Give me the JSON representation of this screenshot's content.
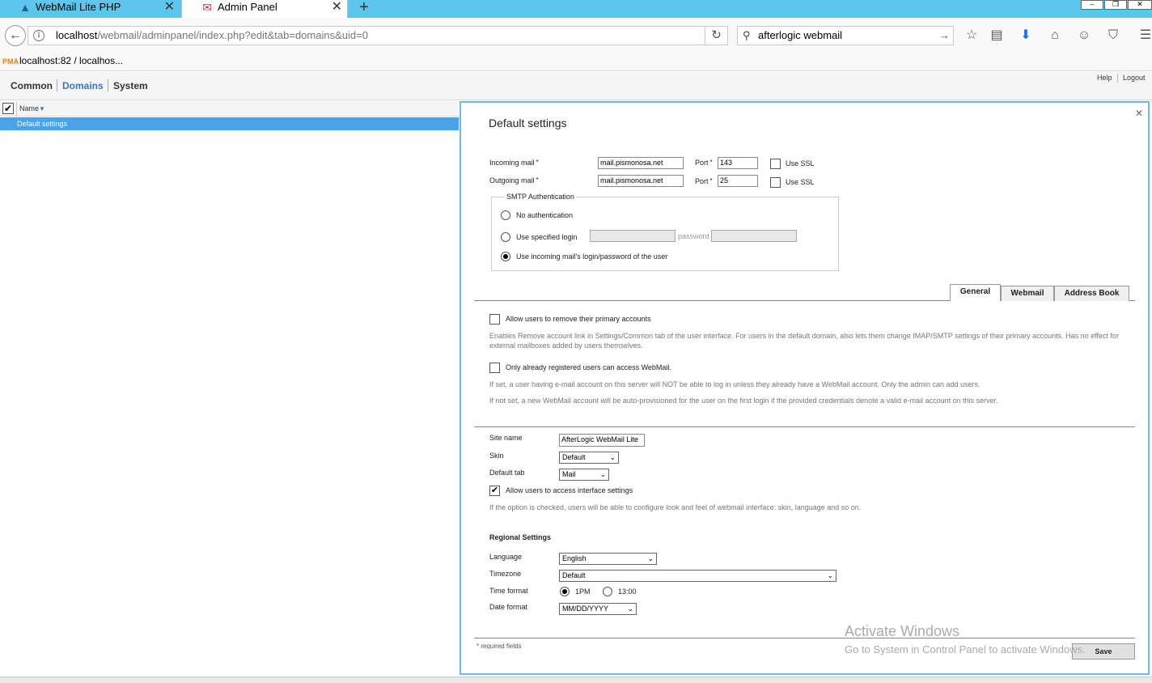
{
  "browser": {
    "tabs": [
      {
        "label": "WebMail Lite PHP"
      },
      {
        "label": "Admin Panel"
      }
    ],
    "url_host": "localhost",
    "url_path": "/webmail/adminpanel/index.php?edit&tab=domains&uid=0",
    "search_value": "afterlogic webmail",
    "bookmark": "localhost:82 / localhos..."
  },
  "app_nav": {
    "common": "Common",
    "domains": "Domains",
    "system": "System",
    "help": "Help",
    "logout": "Logout"
  },
  "list": {
    "column_name": "Name",
    "rows": [
      {
        "label": "Default settings"
      }
    ]
  },
  "panel": {
    "title": "Default settings",
    "incoming_label": "Incoming mail",
    "incoming_value": "mail.pismonosa.net",
    "incoming_port_label": "Port",
    "incoming_port": "143",
    "incoming_ssl_label": "Use SSL",
    "outgoing_label": "Outgoing mail",
    "outgoing_value": "mail.pismonosa.net",
    "outgoing_port_label": "Port",
    "outgoing_port": "25",
    "outgoing_ssl_label": "Use SSL",
    "required_mark": "*",
    "smtp": {
      "legend": "SMTP Authentication",
      "no_auth": "No authentication",
      "specified_login": "Use specified login",
      "password_label": "password",
      "incoming_login": "Use incoming mail's login/password of the user"
    },
    "tabs": {
      "general": "General",
      "webmail": "Webmail",
      "address_book": "Address Book"
    },
    "general": {
      "allow_remove_label": "Allow users to remove their primary accounts",
      "allow_remove_desc": "Enables Remove account link in Settings/Common tab of the user interface. For users in the default domain, also lets them change IMAP/SMTP settings of their primary accounts. Has no effect for external mailboxes added by users themselves.",
      "only_registered_label": "Only already registered users can access WebMail.",
      "only_registered_desc1": "If set, a user having e-mail account on this server will NOT be able to log in unless they already have a WebMail account. Only the admin can add users.",
      "only_registered_desc2": "If not set, a new WebMail account will be auto-provisioned for the user on the first login if the provided credentials denote a valid e-mail account on this server."
    },
    "interface": {
      "site_name_label": "Site name",
      "site_name_value": "AfterLogic WebMail Lite",
      "skin_label": "Skin",
      "skin_value": "Default",
      "default_tab_label": "Default tab",
      "default_tab_value": "Mail",
      "allow_interface_label": "Allow users to access interface settings",
      "allow_interface_desc": "If the option is checked, users will be able to configure look and feel of webmail interface: skin, language and so on."
    },
    "regional": {
      "title": "Regional Settings",
      "language_label": "Language",
      "language_value": "English",
      "timezone_label": "Timezone",
      "timezone_value": "Default",
      "time_format_label": "Time format",
      "time_12": "1PM",
      "time_24": "13:00",
      "date_format_label": "Date format",
      "date_format_value": "MM/DD/YYYY"
    },
    "required_note": "required fields",
    "save": "Save"
  },
  "watermark": {
    "title": "Activate Windows",
    "subtitle": "Go to System in Control Panel to activate Windows."
  }
}
